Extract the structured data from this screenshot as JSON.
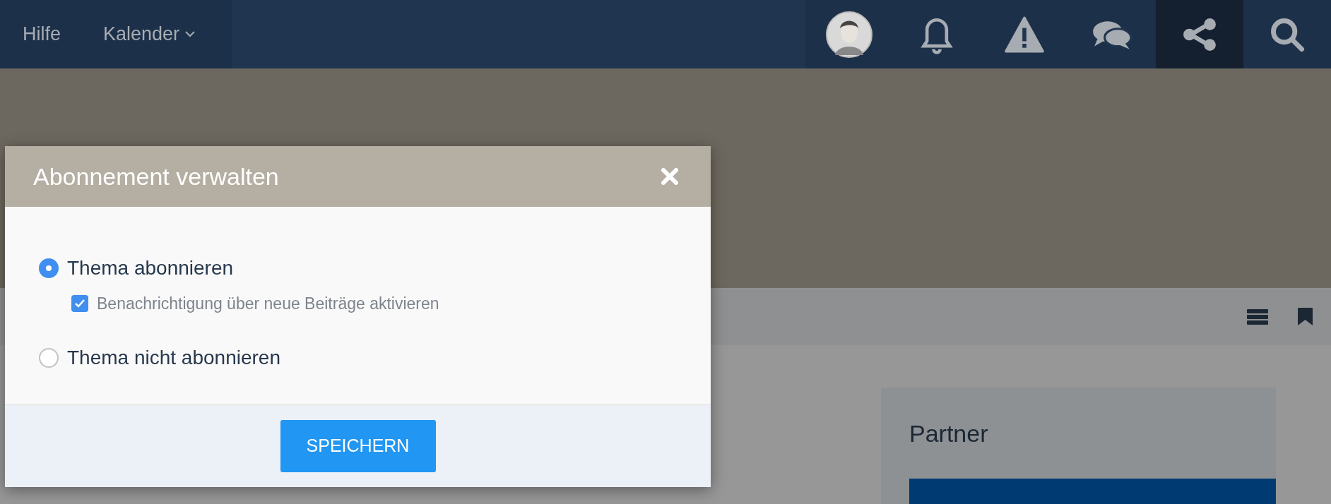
{
  "nav": {
    "items": [
      {
        "label": "Hilfe",
        "kind": "link"
      },
      {
        "label": "Kalender",
        "kind": "dropdown"
      }
    ],
    "icons": [
      {
        "kind": "avatar",
        "selected": false
      },
      {
        "kind": "bell",
        "selected": false
      },
      {
        "kind": "warning",
        "selected": false
      },
      {
        "kind": "chat",
        "selected": false
      },
      {
        "kind": "share",
        "selected": true
      },
      {
        "kind": "search",
        "selected": false
      }
    ]
  },
  "sidebar_card": {
    "title": "Partner"
  },
  "dialog": {
    "title": "Abonnement verwalten",
    "options": [
      {
        "label": "Thema abonnieren",
        "selected": true,
        "suboption": {
          "label": "Benachrichtigung über neue Beiträge aktivieren",
          "checked": true
        }
      },
      {
        "label": "Thema nicht abonnieren",
        "selected": false
      }
    ],
    "button": "SPEICHERN"
  }
}
